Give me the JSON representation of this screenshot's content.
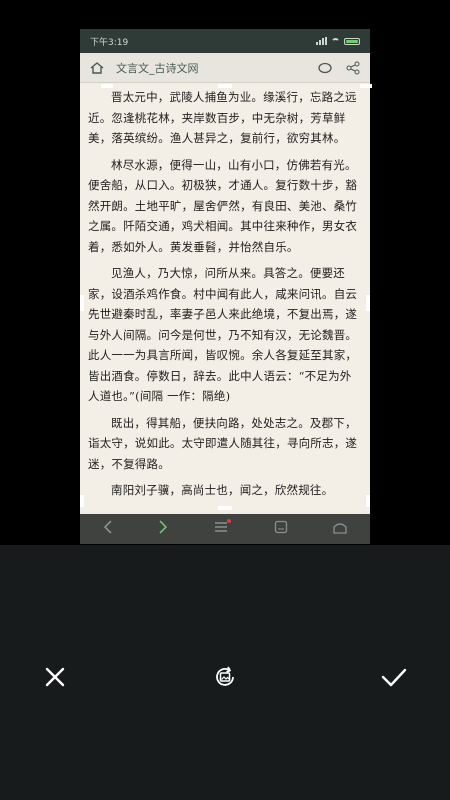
{
  "status_bar": {
    "time": "下午3:19"
  },
  "toolbar": {
    "title": "文言文_古诗文网"
  },
  "article": {
    "paragraphs": [
      "晋太元中，武陵人捕鱼为业。缘溪行，忘路之远近。忽逢桃花林，夹岸数百步，中无杂树，芳草鲜美，落英缤纷。渔人甚异之，复前行，欲穷其林。",
      "林尽水源，便得一山，山有小口，仿佛若有光。便舍船，从口入。初极狭，才通人。复行数十步，豁然开朗。土地平旷，屋舍俨然，有良田、美池、桑竹之属。阡陌交通，鸡犬相闻。其中往来种作，男女衣着，悉如外人。黄发垂髫，并怡然自乐。",
      "见渔人，乃大惊，问所从来。具答之。便要还家，设酒杀鸡作食。村中闻有此人，咸来问讯。自云先世避秦时乱，率妻子邑人来此绝境，不复出焉，遂与外人间隔。问今是何世，乃不知有汉，无论魏晋。此人一一为具言所闻，皆叹惋。余人各复延至其家，皆出酒食。停数日，辞去。此中人语云：“不足为外人道也。”(间隔 一作：隔绝)",
      "既出，得其船，便扶向路，处处志之。及郡下，诣太守，说如此。太守即遣人随其往，寻向所志，遂迷，不复得路。",
      "南阳刘子骥，高尚士也，闻之，欣然规往。"
    ]
  },
  "bottom_nav": {
    "back": "‹",
    "forward": "›",
    "menu": "≡"
  },
  "actions": {
    "cancel_icon": "close-icon",
    "rotate_icon": "rotate-image-icon",
    "confirm_icon": "checkmark-icon"
  }
}
